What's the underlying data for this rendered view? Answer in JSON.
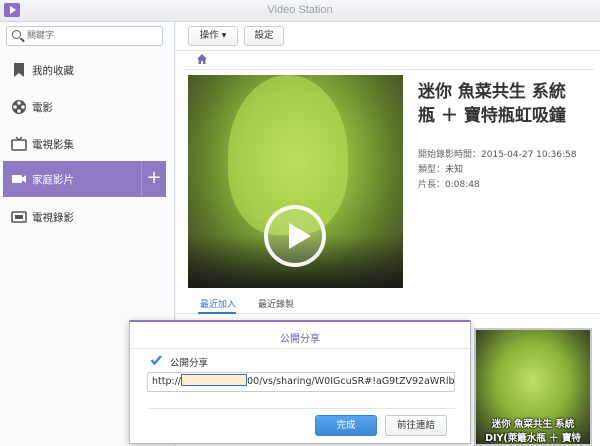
{
  "app": {
    "title": "Video Station"
  },
  "sidebar": {
    "search_placeholder": "關鍵字",
    "items": [
      {
        "label": "我的收藏",
        "icon": "bookmark-icon"
      },
      {
        "label": "電影",
        "icon": "film-reel-icon"
      },
      {
        "label": "電視影集",
        "icon": "tv-icon"
      },
      {
        "label": "家庭影片",
        "icon": "camcorder-icon",
        "active": true
      },
      {
        "label": "電視錄影",
        "icon": "tv-recording-icon"
      }
    ],
    "add_label": "+"
  },
  "toolbar": {
    "action_label": "操作 ▾",
    "settings_label": "設定"
  },
  "video": {
    "title_line1": "迷你 魚菜共生 系統",
    "title_line2": "瓶 ＋ 寶特瓶虹吸鐘",
    "record_time_label": "開始錄影時間：",
    "record_time_value": "2015-04-27 10:36:58",
    "type_label": "類型：",
    "type_value": "未知",
    "length_label": "片長：",
    "length_value": "0:08:48"
  },
  "tabs": [
    {
      "label": "最近加入",
      "active": true
    },
    {
      "label": "最近錄製",
      "active": false
    }
  ],
  "thumbnail": {
    "caption_line1": "迷你 魚菜共生 系統",
    "caption_line2": "DIY(萊籬水瓶 ＋ 寶特"
  },
  "share_dialog": {
    "title": "公開分享",
    "checkbox_label": "公開分享",
    "checked": true,
    "url_prefix": "http://",
    "url_suffix": "00/vs/sharing/W0IGcuSR#!aG9tZV92aWRlb",
    "done_label": "完成",
    "goto_label": "前往連結"
  },
  "colors": {
    "accent": "#8f79c3",
    "primary_button": "#3b87d6",
    "link": "#3778c8"
  }
}
